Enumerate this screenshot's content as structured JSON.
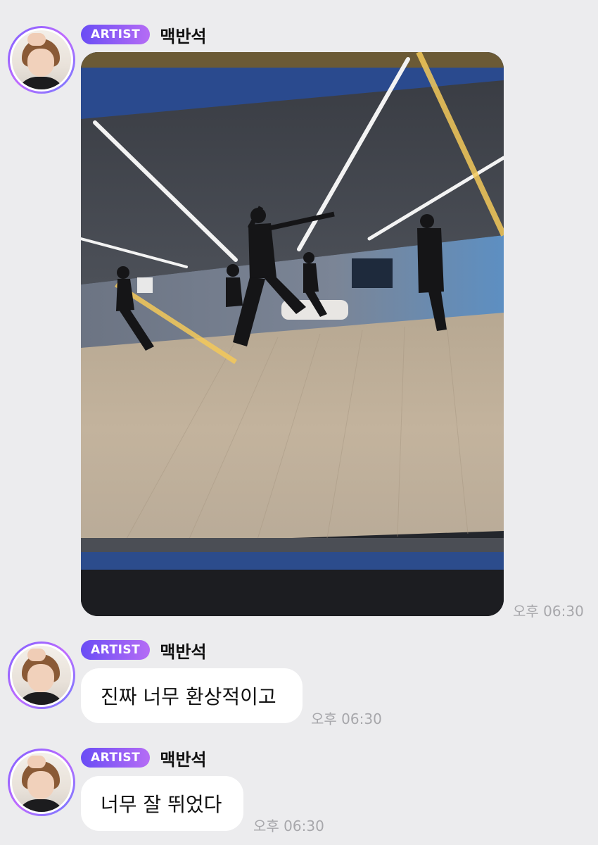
{
  "messages": [
    {
      "badge": "ARTIST",
      "sender": "맥반석",
      "type": "photo",
      "time": "오후 06:30"
    },
    {
      "badge": "ARTIST",
      "sender": "맥반석",
      "type": "text",
      "text": "진짜 너무 환상적이고",
      "time": "오후 06:30"
    },
    {
      "badge": "ARTIST",
      "sender": "맥반석",
      "type": "text",
      "text": "너무 잘 뛰었다",
      "time": "오후 06:30"
    }
  ],
  "colors": {
    "background": "#ececee",
    "badge_start": "#6a4df5",
    "badge_end": "#b56cf5",
    "bubble": "#ffffff",
    "timestamp": "#a7a7ab"
  }
}
